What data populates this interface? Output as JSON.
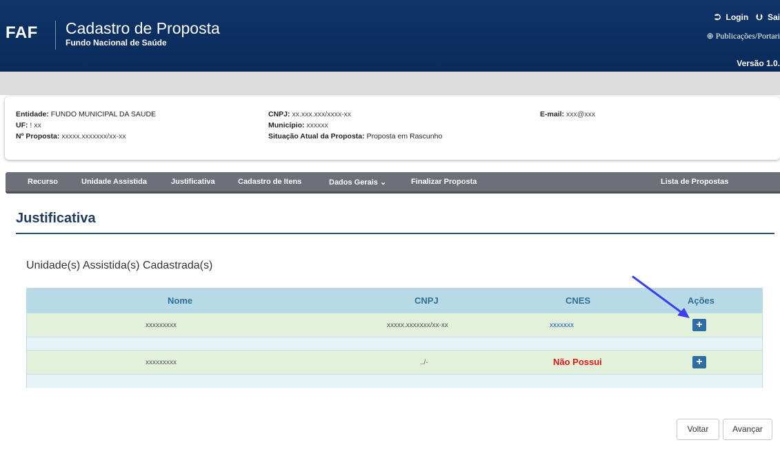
{
  "header": {
    "brand": "FAF",
    "title": "Cadastro de Proposta",
    "subtitle": "Fundo Nacional de Saúde",
    "login_label": "Login",
    "logout_label": "Sai",
    "publications_label": "Publicações/Portari",
    "version_label": "Versão 1.0."
  },
  "info": {
    "entidade_label": "Entidade:",
    "entidade_value": "FUNDO MUNICIPAL DA SAUDE",
    "uf_label": "UF:",
    "uf_value": "! xx",
    "proposta_label": "Nº Proposta:",
    "proposta_value": "xxxxx.xxxxxxx/xx-xx",
    "cnpj_label": "CNPJ:",
    "cnpj_value": "xx.xxx.xxx/xxxx-xx",
    "municipio_label": "Município:",
    "municipio_value": "xxxxxx",
    "situacao_label": "Situação Atual da Proposta:",
    "situacao_value": "Proposta em Rascunho",
    "email_label": "E-mail:",
    "email_value": "xxx@xxx"
  },
  "nav": {
    "recurso": "Recurso",
    "unidade": "Unidade Assistida",
    "justificativa": "Justificativa",
    "cadastro": "Cadastro de Itens",
    "dados": "Dados Gerais",
    "finalizar": "Finalizar Proposta",
    "lista": "Lista de Propostas"
  },
  "page_title": "Justificativa",
  "section_title": "Unidade(s) Assistida(s) Cadastrada(s)",
  "table": {
    "headers": {
      "nome": "Nome",
      "cnpj": "CNPJ",
      "cnes": "CNES",
      "acoes": "Ações"
    },
    "rows": [
      {
        "nome": "xxxxxxxxx",
        "cnpj": "xxxxx.xxxxxxx/xx-xx",
        "cnes": "xxxxxxx"
      },
      {
        "nome": "xxxxxxxxx",
        "cnpj": "../-",
        "cnes": "Não Possui"
      }
    ]
  },
  "buttons": {
    "voltar": "Voltar",
    "avancar": "Avançar"
  },
  "colors": {
    "header_bg": "#0f3468",
    "nav_bg": "#6e7079",
    "plus_btn": "#2f6da5",
    "arrow": "#3b3ff0",
    "no_cnes": "#e01818"
  },
  "icons": {
    "login": "sign-in-icon",
    "logout": "sign-out-icon",
    "publications": "globe-icon",
    "dropdown": "chevron-down-icon",
    "add": "plus-icon"
  }
}
